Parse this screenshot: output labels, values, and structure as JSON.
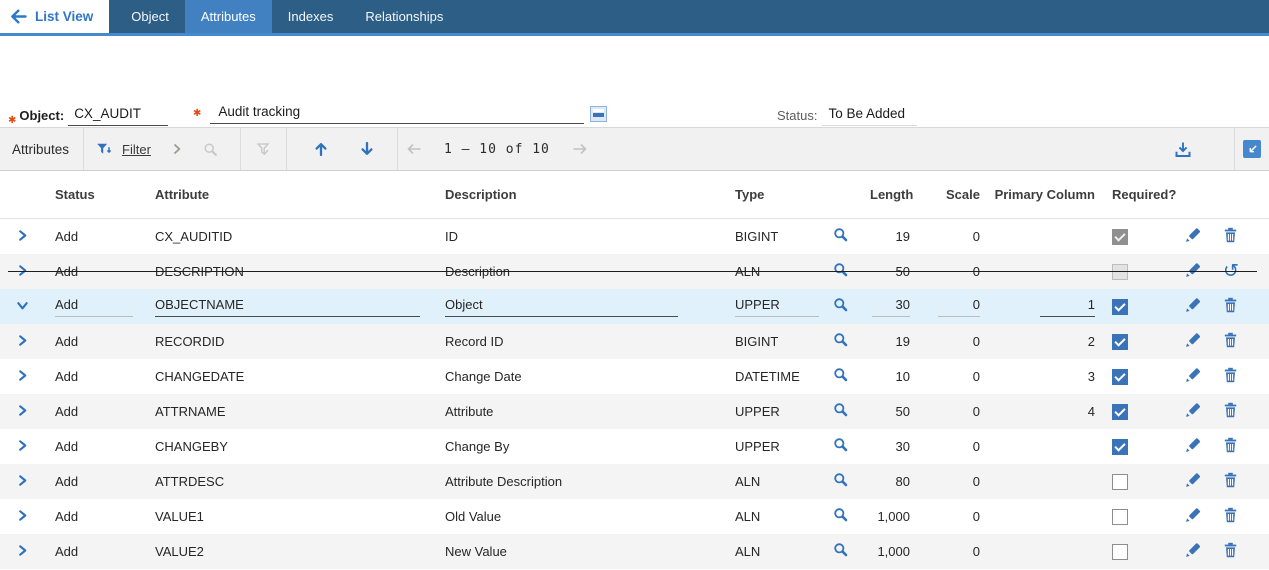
{
  "nav": {
    "back_label": "List View",
    "tabs": [
      {
        "label": "Object",
        "active": false
      },
      {
        "label": "Attributes",
        "active": true
      },
      {
        "label": "Indexes",
        "active": false
      },
      {
        "label": "Relationships",
        "active": false
      }
    ]
  },
  "form": {
    "required_marker": "✱",
    "object_label": "Object:",
    "object_value": "CX_AUDIT",
    "description_value": "Audit tracking",
    "status_label": "Status:",
    "status_value": "To Be Added"
  },
  "toolbar": {
    "title": "Attributes",
    "filter_label": "Filter",
    "pagination_text": "1 – 10 of 10",
    "icons": [
      "filter-funnel-icon",
      "chevron-right-icon",
      "search-icon",
      "clear-filter-icon",
      "move-up-icon",
      "move-down-icon",
      "previous-page-icon",
      "next-page-icon",
      "download-icon",
      "collapse-table-icon"
    ]
  },
  "table": {
    "headers": [
      "Status",
      "Attribute",
      "Description",
      "Type",
      "Length",
      "Scale",
      "Primary Column",
      "Required?"
    ],
    "rows": [
      {
        "status": "Add",
        "attribute": "CX_AUDITID",
        "description": "ID",
        "type": "BIGINT",
        "length": "19",
        "scale": "0",
        "primary": "",
        "required": "checked-disabled",
        "action": "delete",
        "expanded": false,
        "selected": false,
        "struck": false
      },
      {
        "status": "Add",
        "attribute": "DESCRIPTION",
        "description": "Description",
        "type": "ALN",
        "length": "50",
        "scale": "0",
        "primary": "",
        "required": "unchecked-disabled",
        "action": "undo",
        "expanded": false,
        "selected": false,
        "struck": true
      },
      {
        "status": "Add",
        "attribute": "OBJECTNAME",
        "description": "Object",
        "type": "UPPER",
        "length": "30",
        "scale": "0",
        "primary": "1",
        "required": "checked",
        "action": "delete",
        "expanded": true,
        "selected": true,
        "struck": false
      },
      {
        "status": "Add",
        "attribute": "RECORDID",
        "description": "Record ID",
        "type": "BIGINT",
        "length": "19",
        "scale": "0",
        "primary": "2",
        "required": "checked",
        "action": "delete",
        "expanded": false,
        "selected": false,
        "struck": false
      },
      {
        "status": "Add",
        "attribute": "CHANGEDATE",
        "description": "Change Date",
        "type": "DATETIME",
        "length": "10",
        "scale": "0",
        "primary": "3",
        "required": "checked",
        "action": "delete",
        "expanded": false,
        "selected": false,
        "struck": false
      },
      {
        "status": "Add",
        "attribute": "ATTRNAME",
        "description": "Attribute",
        "type": "UPPER",
        "length": "50",
        "scale": "0",
        "primary": "4",
        "required": "checked",
        "action": "delete",
        "expanded": false,
        "selected": false,
        "struck": false
      },
      {
        "status": "Add",
        "attribute": "CHANGEBY",
        "description": "Change By",
        "type": "UPPER",
        "length": "30",
        "scale": "0",
        "primary": "",
        "required": "checked",
        "action": "delete",
        "expanded": false,
        "selected": false,
        "struck": false
      },
      {
        "status": "Add",
        "attribute": "ATTRDESC",
        "description": "Attribute Description",
        "type": "ALN",
        "length": "80",
        "scale": "0",
        "primary": "",
        "required": "unchecked",
        "action": "delete",
        "expanded": false,
        "selected": false,
        "struck": false
      },
      {
        "status": "Add",
        "attribute": "VALUE1",
        "description": "Old Value",
        "type": "ALN",
        "length": "1,000",
        "scale": "0",
        "primary": "",
        "required": "unchecked",
        "action": "delete",
        "expanded": false,
        "selected": false,
        "struck": false
      },
      {
        "status": "Add",
        "attribute": "VALUE2",
        "description": "New Value",
        "type": "ALN",
        "length": "1,000",
        "scale": "0",
        "primary": "",
        "required": "unchecked",
        "action": "delete",
        "expanded": false,
        "selected": false,
        "struck": false
      }
    ]
  },
  "colors": {
    "nav_background": "#2D5E85",
    "active_tab": "#4181C2",
    "accent_stripe": "#4589CE",
    "icon_blue": "#2F72BE",
    "selected_row": "#E1F1FB",
    "alt_row": "#F4F4F4",
    "required_marker_color": "#E8490F"
  }
}
